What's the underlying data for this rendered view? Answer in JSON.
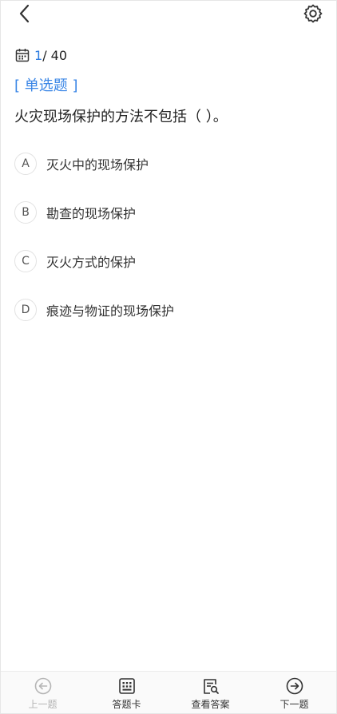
{
  "header": {
    "back_icon": "chevron-left-icon",
    "settings_icon": "gear-icon"
  },
  "progress": {
    "current": "1",
    "total": "/ 40"
  },
  "question": {
    "type": "[ 单选题 ]",
    "text": "火灾现场保护的方法不包括（ ）。",
    "options": [
      {
        "letter": "A",
        "text": "灭火中的现场保护"
      },
      {
        "letter": "B",
        "text": "勘查的现场保护"
      },
      {
        "letter": "C",
        "text": "灭火方式的保护"
      },
      {
        "letter": "D",
        "text": "痕迹与物证的现场保护"
      }
    ]
  },
  "bottom_nav": {
    "prev": "上一题",
    "answer_card": "答题卡",
    "view_answer": "查看答案",
    "next": "下一题"
  },
  "colors": {
    "accent": "#3a86e6",
    "disabled": "#b5b5b5",
    "text": "#222222"
  }
}
